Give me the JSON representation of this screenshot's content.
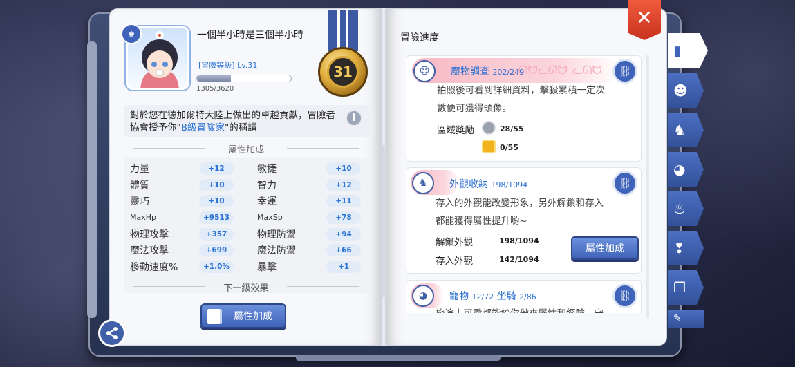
{
  "profile": {
    "name": "一個半小時是三個半小時",
    "level_label": "[冒險等級]",
    "level": "Lv.31",
    "xp": "1305/3620",
    "xp_fraction": 0.36,
    "rank": "31"
  },
  "description": {
    "before": "對於您在德加爾特大陸上做出的卓越貢獻，冒險者協會授予你\"",
    "highlight": "B級冒險家",
    "after": "\"的稱謂"
  },
  "stats_header": "屬性加成",
  "stats": [
    {
      "label": "力量",
      "value": "+12"
    },
    {
      "label": "敏捷",
      "value": "+10"
    },
    {
      "label": "體質",
      "value": "+10"
    },
    {
      "label": "智力",
      "value": "+12"
    },
    {
      "label": "靈巧",
      "value": "+10"
    },
    {
      "label": "幸運",
      "value": "+11"
    },
    {
      "label": "MaxHp",
      "value": "+9513"
    },
    {
      "label": "MaxSp",
      "value": "+78"
    },
    {
      "label": "物理攻擊",
      "value": "+357"
    },
    {
      "label": "物理防禦",
      "value": "+94"
    },
    {
      "label": "魔法攻擊",
      "value": "+699"
    },
    {
      "label": "魔法防禦",
      "value": "+66"
    },
    {
      "label": "移動速度%",
      "value": "+1.0%"
    },
    {
      "label": "暴擊",
      "value": "+1"
    }
  ],
  "next_header": "下一級效果",
  "left_button": "屬性加成",
  "right_title": "冒險進度",
  "cards": [
    {
      "title": "魔物調查",
      "count": "202/249",
      "desc1": "拍照後可看到詳細資料，擊殺累積一定次",
      "desc2": "數便可獲得頭像。",
      "reward_label": "區域獎勵",
      "reward1": "28/55",
      "reward2": "0/55"
    },
    {
      "title": "外觀收納",
      "count": "198/1094",
      "desc1": "存入的外觀能改變形象，另外解鎖和存入",
      "desc2": "都能獲得屬性提升喲~",
      "row1_label": "解鎖外觀",
      "row1_value": "198/1094",
      "row2_label": "存入外觀",
      "row2_value": "142/1094",
      "button": "屬性加成"
    },
    {
      "title": "寵物",
      "count": "12/72",
      "title2": "坐騎",
      "count2": "2/86",
      "desc1": "旅途上可愛都能給你帶來屬性和經驗，守"
    }
  ],
  "colors": {
    "accent": "#3f63b8",
    "link": "#2a72d4",
    "close": "#e04a2e"
  }
}
